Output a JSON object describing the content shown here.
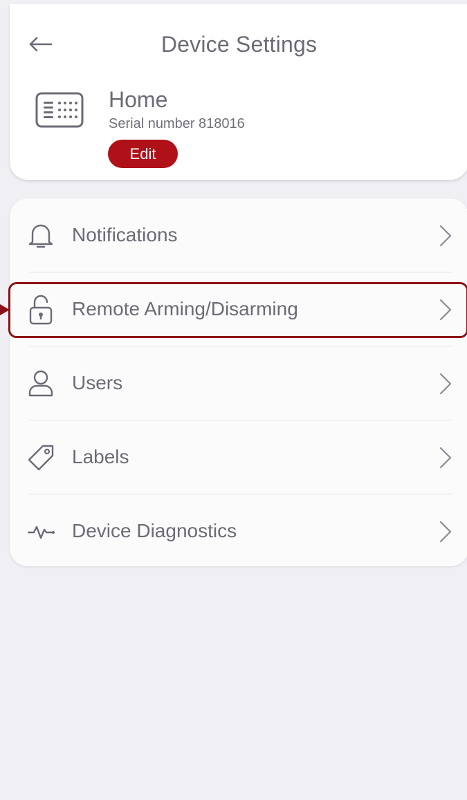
{
  "header": {
    "title": "Device Settings",
    "back_icon": "arrow-left-icon"
  },
  "device": {
    "name": "Home",
    "serial": "Serial number 818016",
    "edit_label": "Edit",
    "icon": "keypad-icon"
  },
  "menu": {
    "items": [
      {
        "label": "Notifications",
        "icon": "bell-icon"
      },
      {
        "label": "Remote Arming/Disarming",
        "icon": "lock-open-icon"
      },
      {
        "label": "Users",
        "icon": "user-icon"
      },
      {
        "label": "Labels",
        "icon": "tag-icon"
      },
      {
        "label": "Device Diagnostics",
        "icon": "pulse-icon"
      }
    ]
  },
  "colors": {
    "accent": "#b01119",
    "highlight": "#8b1116",
    "text": "#6b6b76",
    "background": "#f0eff4"
  }
}
